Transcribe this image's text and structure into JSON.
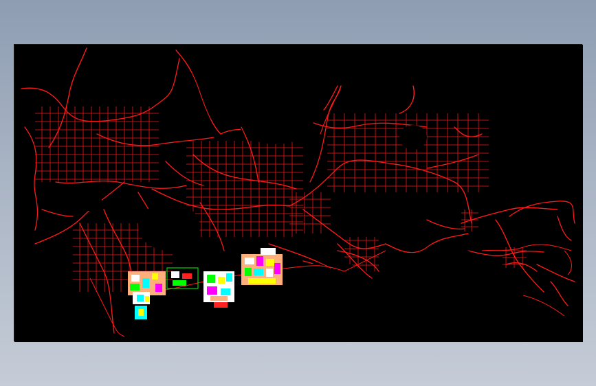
{
  "drawing": {
    "background_color": "#000000",
    "road_color": "#ff1a1a",
    "detail_colors": [
      "#ffffff",
      "#00ffff",
      "#ff00ff",
      "#ffff00",
      "#00ff00",
      "#ffb07a",
      "#ff2020"
    ]
  }
}
